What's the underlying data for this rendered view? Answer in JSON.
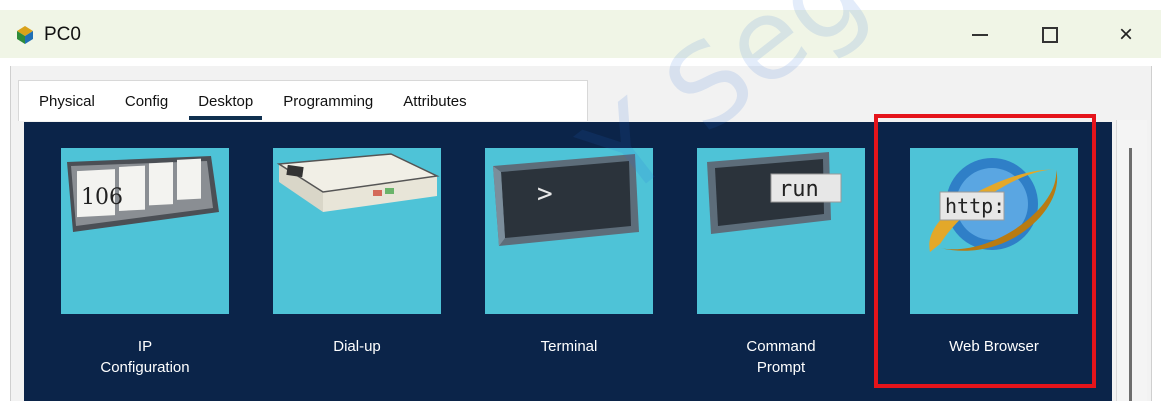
{
  "window": {
    "title": "PC0",
    "icon": "packet-tracer-pc-icon",
    "controls": {
      "minimize": "minimize-icon",
      "maximize": "maximize-icon",
      "close": "×"
    }
  },
  "tabs": [
    {
      "label": "Physical",
      "active": false
    },
    {
      "label": "Config",
      "active": false
    },
    {
      "label": "Desktop",
      "active": true
    },
    {
      "label": "Programming",
      "active": false
    },
    {
      "label": "Attributes",
      "active": false
    }
  ],
  "apps": [
    {
      "label": "IP\nConfiguration",
      "icon": "ip-configuration-icon",
      "icon_text": "106"
    },
    {
      "label": "Dial-up",
      "icon": "modem-icon"
    },
    {
      "label": "Terminal",
      "icon": "terminal-icon",
      "icon_text": ">"
    },
    {
      "label": "Command\nPrompt",
      "icon": "command-prompt-icon",
      "icon_text": "run"
    },
    {
      "label": "Web Browser",
      "icon": "web-browser-icon",
      "icon_text": "http:"
    }
  ],
  "watermark": {
    "text": "Y Seguridad"
  },
  "colors": {
    "desktop_background": "#0b2449",
    "tile_background": "#4ec3d7",
    "highlight": "#e5141b",
    "active_tab_underline": "#10304f"
  }
}
